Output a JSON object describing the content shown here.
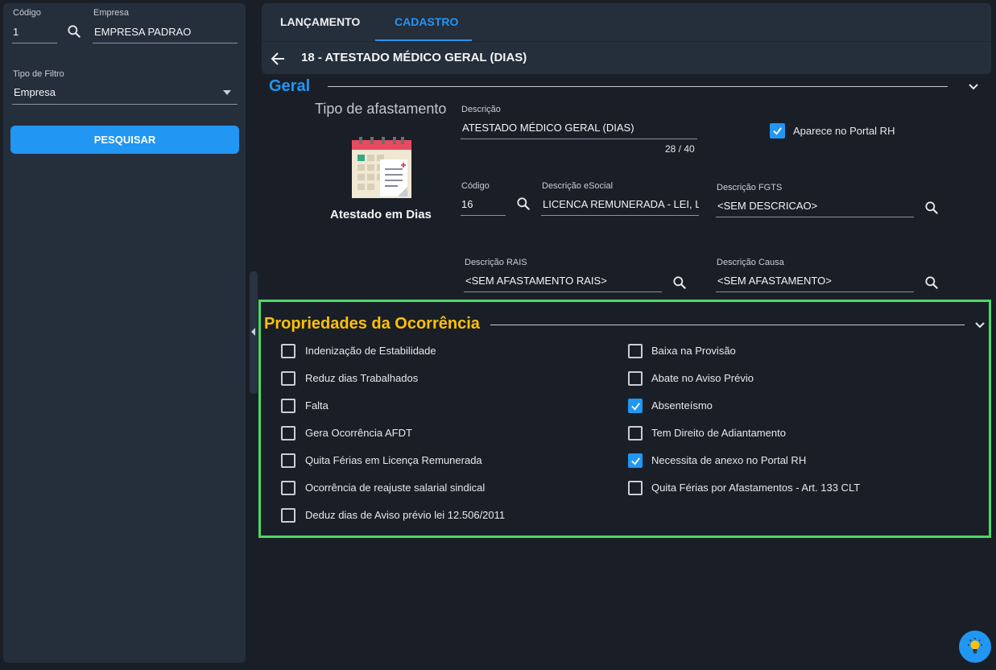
{
  "left": {
    "codigo_label": "Código",
    "codigo_value": "1",
    "empresa_label": "Empresa",
    "empresa_value": "EMPRESA PADRAO",
    "tipo_filtro_label": "Tipo de Filtro",
    "tipo_filtro_value": "Empresa",
    "pesquisar_label": "PESQUISAR"
  },
  "tabs": [
    {
      "label": "LANÇAMENTO",
      "active": false
    },
    {
      "label": "CADASTRO",
      "active": true
    }
  ],
  "header": {
    "title": "18 - ATESTADO MÉDICO GERAL (DIAS)"
  },
  "geral": {
    "section_title": "Geral",
    "tipo_afastamento_label": "Tipo de afastamento",
    "image_caption": "Atestado em Dias",
    "descricao_label": "Descrição",
    "descricao_value": "ATESTADO MÉDICO GERAL (DIAS)",
    "descricao_counter": "28 / 40",
    "portal_rh_label": "Aparece no Portal RH",
    "portal_rh_checked": true,
    "codigo_label": "Código",
    "codigo_value": "16",
    "esocial_label": "Descrição eSocial",
    "esocial_value": "LICENCA REMUNERADA - LEI, LIB",
    "fgts_label": "Descrição FGTS",
    "fgts_value": "<SEM DESCRICAO>",
    "rais_label": "Descrição RAIS",
    "rais_value": "<SEM AFASTAMENTO RAIS>",
    "causa_label": "Descrição Causa",
    "causa_value": "<SEM AFASTAMENTO>"
  },
  "props": {
    "section_title": "Propriedades da Ocorrência",
    "left_items": [
      {
        "label": "Indenização de Estabilidade",
        "checked": false
      },
      {
        "label": "Reduz dias Trabalhados",
        "checked": false
      },
      {
        "label": "Falta",
        "checked": false
      },
      {
        "label": "Gera Ocorrência AFDT",
        "checked": false
      },
      {
        "label": "Quita Férias em Licença Remunerada",
        "checked": false
      },
      {
        "label": "Ocorrência de reajuste salarial sindical",
        "checked": false
      },
      {
        "label": "Deduz dias de Aviso prévio lei 12.506/2011",
        "checked": false
      }
    ],
    "right_items": [
      {
        "label": "Baixa na Provisão",
        "checked": false
      },
      {
        "label": "Abate no Aviso Prévio",
        "checked": false
      },
      {
        "label": "Absenteísmo",
        "checked": true
      },
      {
        "label": "Tem Direito de Adiantamento",
        "checked": false
      },
      {
        "label": "Necessita de anexo no Portal RH",
        "checked": true
      },
      {
        "label": "Quita Férias por Afastamentos - Art. 133 CLT",
        "checked": false
      }
    ]
  },
  "colors": {
    "accent": "#2196f3",
    "highlight": "#4cd964",
    "section_yellow": "#ffc107"
  }
}
